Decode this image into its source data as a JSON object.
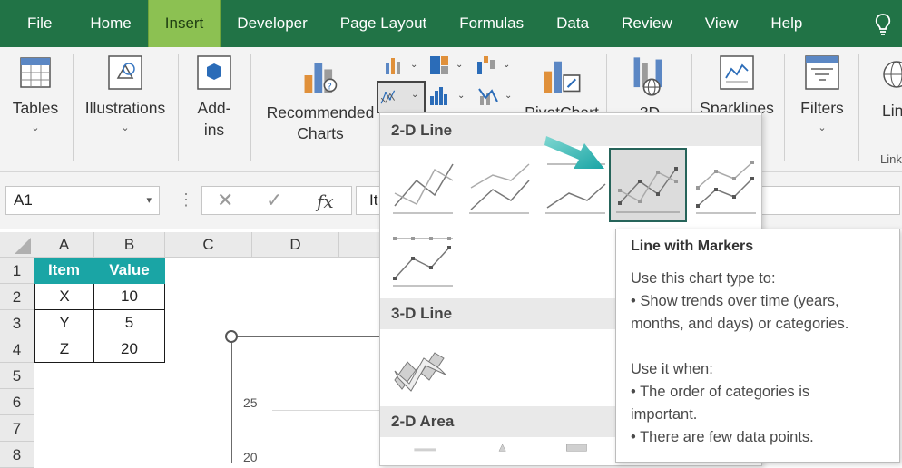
{
  "menu": {
    "tabs": [
      "File",
      "Home",
      "Insert",
      "Developer",
      "Page Layout",
      "Formulas",
      "Data",
      "Review",
      "View",
      "Help"
    ],
    "active": "Insert"
  },
  "ribbon": {
    "tables": "Tables",
    "illustrations": "Illustrations",
    "addins_1": "Add-",
    "addins_2": "ins",
    "recommended_1": "Recommended",
    "recommended_2": "Charts",
    "pivotchart": "PivotChart",
    "map3d": "3D",
    "sparklines": "Sparklines",
    "filters": "Filters",
    "links": "Lin",
    "links_group": "Link"
  },
  "formula_bar": {
    "name_box": "A1",
    "fx": "fx",
    "cancel": "✕",
    "enter": "✓",
    "content": "It"
  },
  "grid": {
    "columns": [
      "A",
      "B",
      "C",
      "D"
    ],
    "rows": [
      "1",
      "2",
      "3",
      "4",
      "5",
      "6",
      "7",
      "8"
    ],
    "header": [
      "Item",
      "Value"
    ],
    "data": [
      [
        "X",
        "10"
      ],
      [
        "Y",
        "5"
      ],
      [
        "Z",
        "20"
      ]
    ]
  },
  "chart_axis": {
    "ticks": [
      "25",
      "20"
    ]
  },
  "dropdown": {
    "sections": [
      "2-D Line",
      "3-D Line",
      "2-D Area"
    ],
    "selected": "Line with Markers"
  },
  "tooltip": {
    "title": "Line with Markers",
    "line1": "Use this chart type to:",
    "line2": "• Show trends over time (years,",
    "line3": "months, and days) or categories.",
    "line4": "Use it when:",
    "line5": "• The order of categories is",
    "line6": "important.",
    "line7": "• There are few data points."
  },
  "colors": {
    "menu_bg": "#217346",
    "active_tab": "#8cc152",
    "table_header": "#1aa5a5",
    "arrow": "#1aa5a5"
  }
}
